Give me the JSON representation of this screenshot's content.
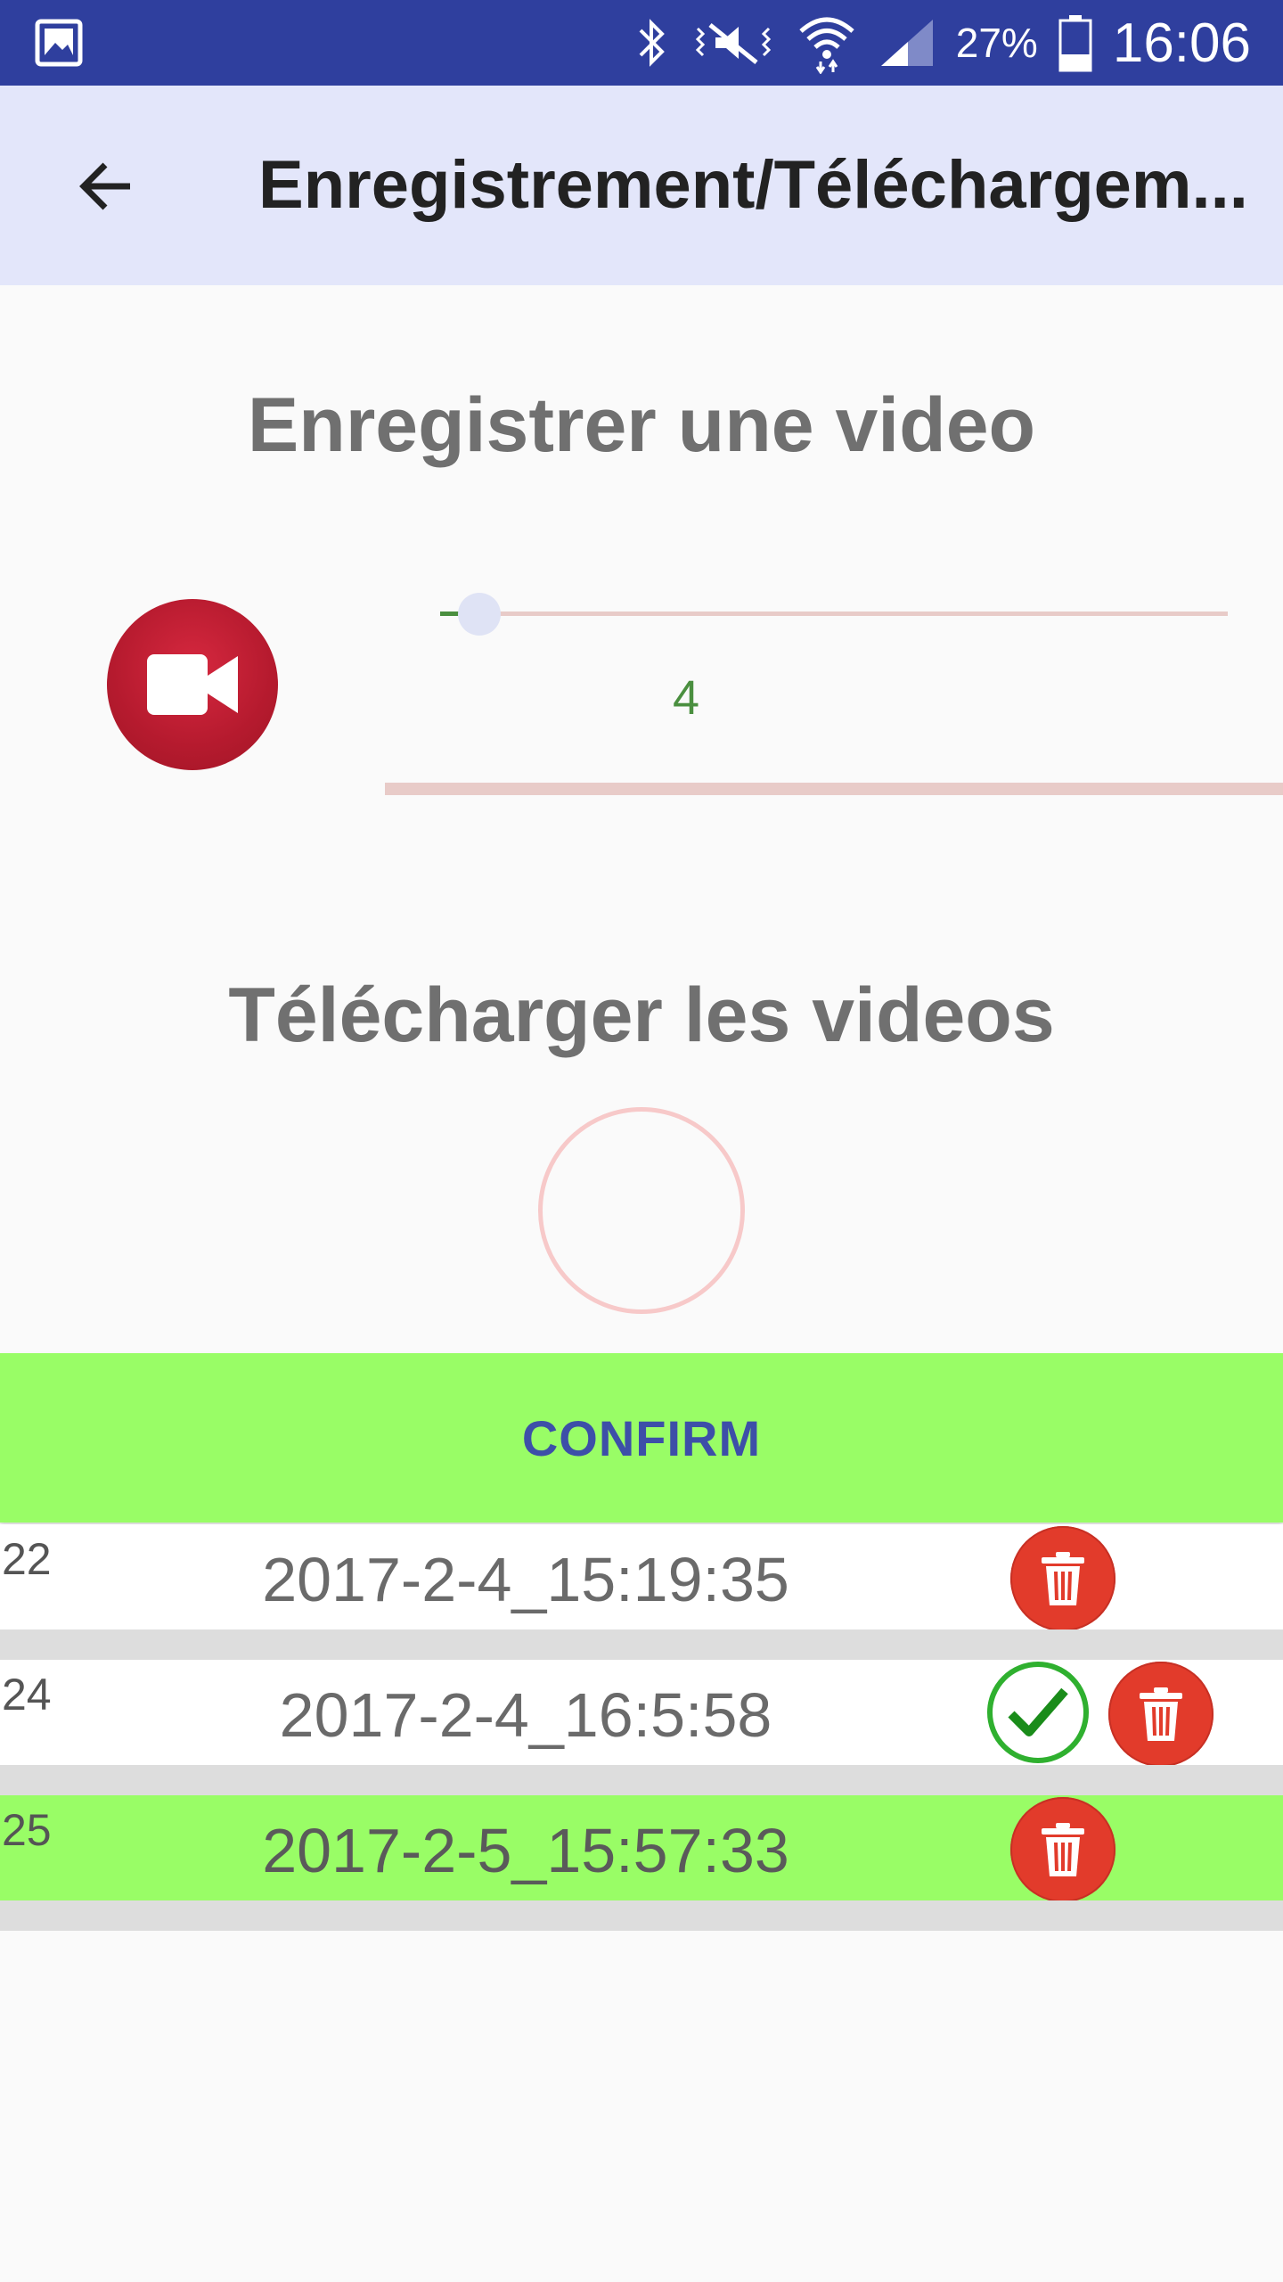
{
  "status_bar": {
    "battery_text": "27%",
    "time": "16:06",
    "icons": [
      "gallery-icon",
      "bluetooth-icon",
      "vibrate-mute-icon",
      "wifi-icon",
      "signal-icon",
      "battery-icon"
    ]
  },
  "app_bar": {
    "title": "Enregistrement/Téléchargem..."
  },
  "record_section": {
    "title": "Enregistrer une video",
    "slider_value": "4",
    "slider_fraction": 0.05
  },
  "download_section": {
    "title": "Télécharger les videos"
  },
  "confirm": {
    "label": "CONFIRM"
  },
  "videos": [
    {
      "id": "22",
      "date": "2017-2-4_15:19:35",
      "selected": false,
      "checked": false
    },
    {
      "id": "24",
      "date": "2017-2-4_16:5:58",
      "selected": false,
      "checked": true
    },
    {
      "id": "25",
      "date": "2017-2-5_15:57:33",
      "selected": true,
      "checked": false
    }
  ],
  "colors": {
    "status_bar": "#2f3f9e",
    "app_bar": "#e3e6fa",
    "accent_green": "#99fd66",
    "record_red": "#b51a2e",
    "delete_red": "#e23b2b",
    "confirm_text": "#3d4fa8",
    "slider_green": "#4a8f3f"
  }
}
